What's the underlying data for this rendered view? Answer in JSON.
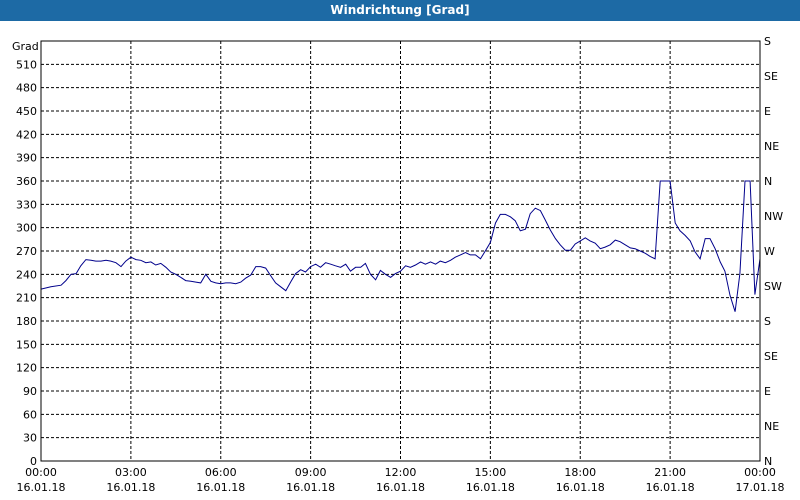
{
  "window_title": "Windrichtung [Grad]",
  "chart_data": {
    "type": "line",
    "title": "Windrichtung [Grad]",
    "ylabel": "Grad",
    "ylim": [
      0,
      540
    ],
    "xlim": [
      0,
      24
    ],
    "y_ticks": [
      0,
      30,
      60,
      90,
      120,
      150,
      180,
      210,
      240,
      270,
      300,
      330,
      360,
      390,
      420,
      450,
      480,
      510
    ],
    "right_ticks": [
      "N",
      "NE",
      "E",
      "SE",
      "S",
      "SW",
      "W",
      "NW",
      "N",
      "NE",
      "E",
      "SE",
      "S"
    ],
    "x_ticks": [
      {
        "time": "00:00",
        "date": "16.01.18",
        "hour": 0
      },
      {
        "time": "03:00",
        "date": "16.01.18",
        "hour": 3
      },
      {
        "time": "06:00",
        "date": "16.01.18",
        "hour": 6
      },
      {
        "time": "09:00",
        "date": "16.01.18",
        "hour": 9
      },
      {
        "time": "12:00",
        "date": "16.01.18",
        "hour": 12
      },
      {
        "time": "15:00",
        "date": "16.01.18",
        "hour": 15
      },
      {
        "time": "18:00",
        "date": "16.01.18",
        "hour": 18
      },
      {
        "time": "21:00",
        "date": "16.01.18",
        "hour": 21
      },
      {
        "time": "00:00",
        "date": "17.01.18",
        "hour": 24
      }
    ],
    "grid": true,
    "line_color": "#00008b",
    "series": [
      {
        "points": [
          [
            0.0,
            221
          ],
          [
            0.33,
            224
          ],
          [
            0.67,
            226
          ],
          [
            0.83,
            232
          ],
          [
            1.0,
            240
          ],
          [
            1.17,
            241
          ],
          [
            1.33,
            251
          ],
          [
            1.5,
            259
          ],
          [
            1.67,
            258
          ],
          [
            1.83,
            257
          ],
          [
            2.0,
            257
          ],
          [
            2.17,
            258
          ],
          [
            2.33,
            257
          ],
          [
            2.5,
            255
          ],
          [
            2.67,
            250
          ],
          [
            2.83,
            257
          ],
          [
            3.0,
            262
          ],
          [
            3.17,
            259
          ],
          [
            3.33,
            258
          ],
          [
            3.5,
            255
          ],
          [
            3.67,
            256
          ],
          [
            3.83,
            252
          ],
          [
            4.0,
            254
          ],
          [
            4.17,
            249
          ],
          [
            4.33,
            243
          ],
          [
            4.5,
            240
          ],
          [
            4.67,
            236
          ],
          [
            4.83,
            232
          ],
          [
            5.0,
            231
          ],
          [
            5.17,
            230
          ],
          [
            5.33,
            229
          ],
          [
            5.5,
            240
          ],
          [
            5.67,
            231
          ],
          [
            5.83,
            229
          ],
          [
            6.0,
            228
          ],
          [
            6.17,
            229
          ],
          [
            6.33,
            229
          ],
          [
            6.5,
            228
          ],
          [
            6.67,
            230
          ],
          [
            6.83,
            235
          ],
          [
            7.0,
            239
          ],
          [
            7.17,
            250
          ],
          [
            7.33,
            250
          ],
          [
            7.5,
            248
          ],
          [
            7.67,
            238
          ],
          [
            7.83,
            229
          ],
          [
            8.0,
            224
          ],
          [
            8.17,
            219
          ],
          [
            8.33,
            230
          ],
          [
            8.5,
            241
          ],
          [
            8.67,
            246
          ],
          [
            8.83,
            243
          ],
          [
            9.0,
            250
          ],
          [
            9.17,
            253
          ],
          [
            9.33,
            249
          ],
          [
            9.5,
            255
          ],
          [
            9.67,
            253
          ],
          [
            9.83,
            251
          ],
          [
            10.0,
            249
          ],
          [
            10.17,
            253
          ],
          [
            10.33,
            244
          ],
          [
            10.5,
            249
          ],
          [
            10.67,
            249
          ],
          [
            10.83,
            254
          ],
          [
            11.0,
            240
          ],
          [
            11.17,
            233
          ],
          [
            11.33,
            245
          ],
          [
            11.5,
            240
          ],
          [
            11.67,
            236
          ],
          [
            11.83,
            241
          ],
          [
            12.0,
            244
          ],
          [
            12.17,
            251
          ],
          [
            12.33,
            249
          ],
          [
            12.5,
            252
          ],
          [
            12.67,
            256
          ],
          [
            12.83,
            253
          ],
          [
            13.0,
            256
          ],
          [
            13.17,
            253
          ],
          [
            13.33,
            257
          ],
          [
            13.5,
            255
          ],
          [
            13.67,
            258
          ],
          [
            13.83,
            262
          ],
          [
            14.0,
            265
          ],
          [
            14.17,
            268
          ],
          [
            14.33,
            265
          ],
          [
            14.5,
            265
          ],
          [
            14.67,
            260
          ],
          [
            14.83,
            270
          ],
          [
            15.0,
            281
          ],
          [
            15.17,
            306
          ],
          [
            15.33,
            317
          ],
          [
            15.5,
            317
          ],
          [
            15.67,
            314
          ],
          [
            15.83,
            309
          ],
          [
            16.0,
            296
          ],
          [
            16.17,
            298
          ],
          [
            16.33,
            318
          ],
          [
            16.5,
            325
          ],
          [
            16.67,
            322
          ],
          [
            16.83,
            310
          ],
          [
            17.0,
            297
          ],
          [
            17.17,
            286
          ],
          [
            17.33,
            278
          ],
          [
            17.5,
            271
          ],
          [
            17.67,
            271
          ],
          [
            17.83,
            279
          ],
          [
            18.0,
            283
          ],
          [
            18.17,
            287
          ],
          [
            18.33,
            283
          ],
          [
            18.5,
            280
          ],
          [
            18.67,
            273
          ],
          [
            18.83,
            275
          ],
          [
            19.0,
            278
          ],
          [
            19.17,
            284
          ],
          [
            19.33,
            282
          ],
          [
            19.5,
            278
          ],
          [
            19.67,
            274
          ],
          [
            19.83,
            273
          ],
          [
            20.0,
            270
          ],
          [
            20.17,
            267
          ],
          [
            20.33,
            263
          ],
          [
            20.5,
            260
          ],
          [
            20.67,
            360
          ],
          [
            20.83,
            360
          ],
          [
            21.0,
            360
          ],
          [
            21.17,
            306
          ],
          [
            21.33,
            296
          ],
          [
            21.5,
            290
          ],
          [
            21.67,
            283
          ],
          [
            21.83,
            269
          ],
          [
            22.0,
            260
          ],
          [
            22.17,
            286
          ],
          [
            22.33,
            286
          ],
          [
            22.5,
            273
          ],
          [
            22.67,
            256
          ],
          [
            22.83,
            244
          ],
          [
            23.0,
            213
          ],
          [
            23.17,
            192
          ],
          [
            23.33,
            241
          ],
          [
            23.5,
            360
          ],
          [
            23.67,
            360
          ],
          [
            23.83,
            214
          ],
          [
            24.0,
            260
          ]
        ]
      }
    ]
  }
}
